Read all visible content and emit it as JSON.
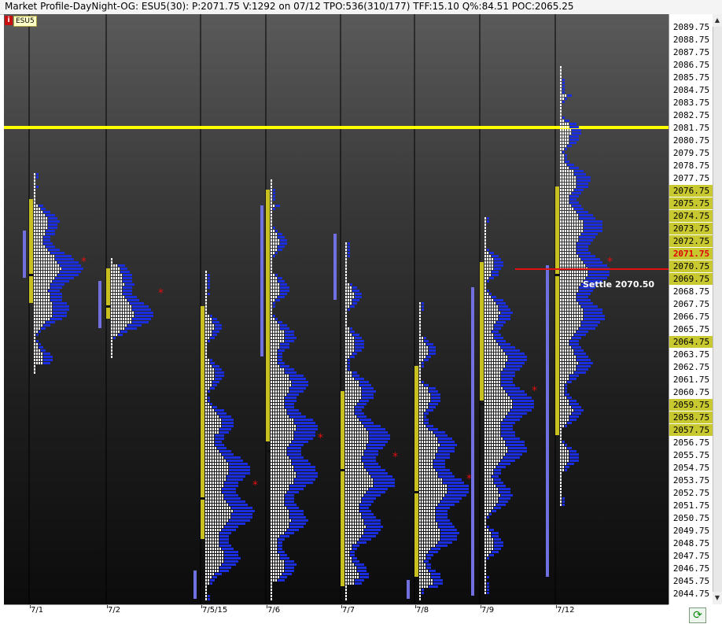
{
  "window": {
    "title": "Market Profile-DayNight-OG: ESU5(30): P:2071.75 V:1292 on 07/12 TPO:536(310/177)  TFF:15.10 Q%:84.51 POC:2065.25"
  },
  "badges": {
    "info": "i",
    "symbol": "ESU5",
    "mode": "M"
  },
  "price_axis": {
    "labels": [
      "2089.75",
      "2088.75",
      "2087.75",
      "2086.75",
      "2085.75",
      "2084.75",
      "2083.75",
      "2082.75",
      "2081.75",
      "2080.75",
      "2079.75",
      "2078.75",
      "2077.75",
      "2076.75",
      "2075.75",
      "2074.75",
      "2073.75",
      "2072.75",
      "2071.75",
      "2070.75",
      "2069.75",
      "2068.75",
      "2067.75",
      "2066.75",
      "2065.75",
      "2064.75",
      "2063.75",
      "2062.75",
      "2061.75",
      "2060.75",
      "2059.75",
      "2058.75",
      "2057.75",
      "2056.75",
      "2055.75",
      "2054.75",
      "2053.75",
      "2052.75",
      "2051.75",
      "2050.75",
      "2049.75",
      "2048.75",
      "2047.75",
      "2046.75",
      "2045.75",
      "2044.75"
    ],
    "current_price": "2071.75",
    "highlighted_range": [
      "2076.75",
      "2064.75",
      "2057.75"
    ]
  },
  "date_axis": {
    "labels": [
      "7/1",
      "7/2",
      "7/5/15",
      "7/6",
      "7/7",
      "7/8",
      "7/9",
      "7/12"
    ]
  },
  "annotations": {
    "settle_label": "Settle 2070.50"
  },
  "toolbar": {
    "refresh_glyph": "⟳"
  },
  "colors": {
    "tpo_white": "#ffffff",
    "tpo_blue": "#1a2ee0",
    "value_area_bar": "#c8c020",
    "poc_marker": "#e01010",
    "yellow_line": "#ffff00",
    "settle_line": "#e01010",
    "background_top": "#5a5a5a",
    "background_bottom": "#0c0c0c"
  },
  "chart_data": {
    "type": "market-profile",
    "tick_size": 0.25,
    "current_price": 2071.75,
    "yellow_level": 2081.75,
    "settle": 2070.5,
    "sessions": [
      {
        "date": "7/1",
        "high": 2078.0,
        "low": 2062.25,
        "va": [
          2076.0,
          2067.75
        ],
        "poc": 2070.0
      },
      {
        "date": "7/2",
        "high": 2071.25,
        "low": 2063.5,
        "va": [
          2070.5,
          2066.5
        ],
        "poc": 2067.5
      },
      {
        "date": "7/5/15",
        "high": 2070.25,
        "low": 2044.25,
        "va": [
          2067.5,
          2049.0
        ],
        "poc": 2052.25
      },
      {
        "date": "7/6",
        "high": 2077.5,
        "low": 2044.25,
        "va": [
          2076.75,
          2056.75
        ],
        "poc": 2056.0
      },
      {
        "date": "7/7",
        "high": 2072.5,
        "low": 2044.25,
        "va": [
          2060.75,
          2045.25
        ],
        "poc": 2054.5
      },
      {
        "date": "7/8",
        "high": 2067.75,
        "low": 2044.25,
        "va": [
          2062.75,
          2046.0
        ],
        "poc": 2052.75
      },
      {
        "date": "7/9",
        "high": 2074.5,
        "low": 2044.75,
        "va": [
          2071.0,
          2060.0
        ],
        "poc": 2059.75
      },
      {
        "date": "7/12",
        "high": 2086.5,
        "low": 2051.75,
        "va": [
          2077.0,
          2057.25
        ],
        "poc": 2070.0
      }
    ]
  }
}
